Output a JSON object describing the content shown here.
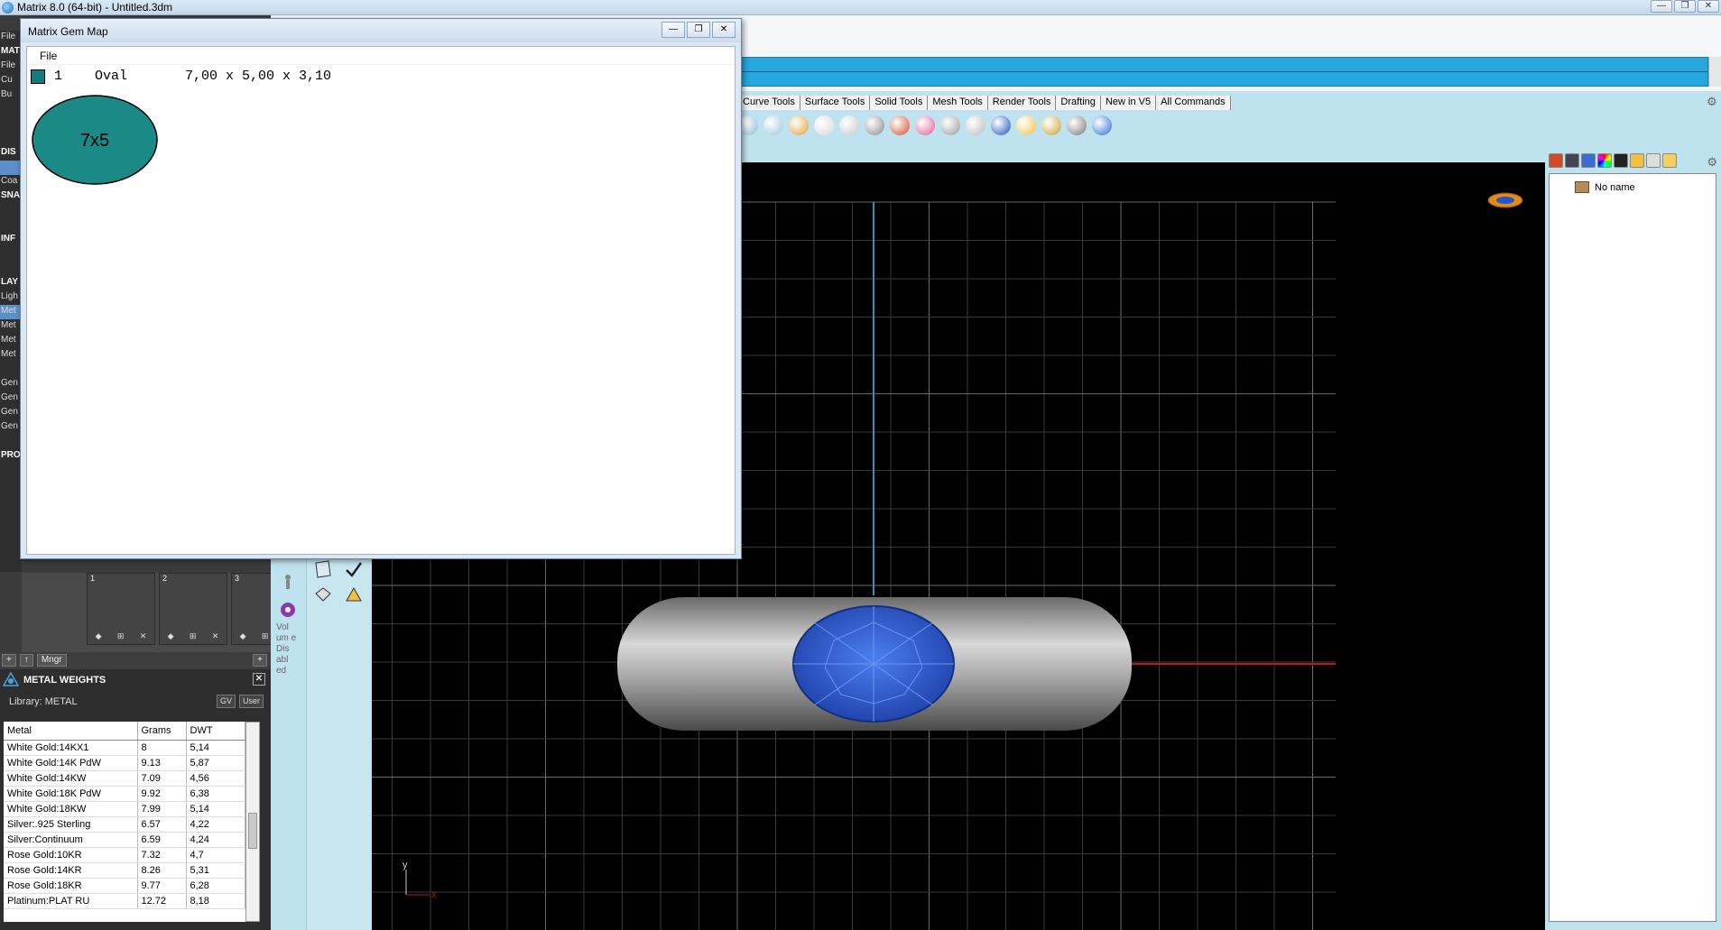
{
  "app": {
    "title": "Matrix 8.0 (64-bit) - Untitled.3dm",
    "window_controls": [
      "—",
      "❐",
      "✕"
    ]
  },
  "left_menu": {
    "items": [
      {
        "label": "File",
        "head": false,
        "hl": false
      },
      {
        "label": "MAT",
        "head": true,
        "hl": false
      },
      {
        "label": "File",
        "head": false,
        "hl": false
      },
      {
        "label": "Cu",
        "head": false,
        "hl": false
      },
      {
        "label": "Bu",
        "head": false,
        "hl": false
      },
      {
        "label": "",
        "head": false,
        "hl": false
      },
      {
        "label": "",
        "head": false,
        "hl": false
      },
      {
        "label": "",
        "head": false,
        "hl": false
      },
      {
        "label": "DIS",
        "head": true,
        "hl": false
      },
      {
        "label": "",
        "head": false,
        "hl": true
      },
      {
        "label": "Coa",
        "head": false,
        "hl": false
      },
      {
        "label": "SNA",
        "head": true,
        "hl": false
      },
      {
        "label": "",
        "head": false,
        "hl": false
      },
      {
        "label": "",
        "head": false,
        "hl": false
      },
      {
        "label": "INF",
        "head": true,
        "hl": false
      },
      {
        "label": "",
        "head": false,
        "hl": false
      },
      {
        "label": "",
        "head": false,
        "hl": false
      },
      {
        "label": "LAY",
        "head": true,
        "hl": false
      },
      {
        "label": "Ligh",
        "head": false,
        "hl": false
      },
      {
        "label": "Met",
        "head": false,
        "hl": true
      },
      {
        "label": "Met",
        "head": false,
        "hl": false
      },
      {
        "label": "Met",
        "head": false,
        "hl": false
      },
      {
        "label": "Met",
        "head": false,
        "hl": false
      },
      {
        "label": "",
        "head": false,
        "hl": false
      },
      {
        "label": "Gen",
        "head": false,
        "hl": false
      },
      {
        "label": "Gen",
        "head": false,
        "hl": false
      },
      {
        "label": "Gen",
        "head": false,
        "hl": false
      },
      {
        "label": "Gen",
        "head": false,
        "hl": false
      },
      {
        "label": "",
        "head": false,
        "hl": false
      },
      {
        "label": "PRO",
        "head": true,
        "hl": false
      }
    ]
  },
  "layer_slots": {
    "slots": [
      "1",
      "2",
      "3"
    ],
    "bar_glyphs": [
      "◆",
      "⊞",
      "✕"
    ],
    "toolbar": [
      "+",
      "↑",
      "Mngr",
      "+"
    ]
  },
  "gem_map": {
    "title": "Matrix Gem Map",
    "menu_file": "File",
    "row": {
      "index": "1",
      "shape": "Oval",
      "size": "7,00 x 5,00 x 3,10"
    },
    "swatch_color": "#137b7b",
    "oval_label": "7x5",
    "oval_color": "#1b8a87"
  },
  "metal_weights": {
    "title": "METAL WEIGHTS",
    "library": "Library: METAL",
    "toggle_gv": "GV",
    "toggle_user": "User",
    "columns": [
      "Metal",
      "Grams",
      "DWT"
    ],
    "rows": [
      [
        "White Gold:14KX1",
        "8",
        "5,14"
      ],
      [
        "White Gold:14K PdW",
        "9.13",
        "5,87"
      ],
      [
        "White Gold:14KW",
        "7.09",
        "4,56"
      ],
      [
        "White Gold:18K PdW",
        "9.92",
        "6,38"
      ],
      [
        "White Gold:18KW",
        "7.99",
        "5,14"
      ],
      [
        "Silver:.925 Sterling",
        "6.57",
        "4,22"
      ],
      [
        "Silver:Continuum",
        "6.59",
        "4,24"
      ],
      [
        "Rose Gold:10KR",
        "7.32",
        "4,7"
      ],
      [
        "Rose Gold:14KR",
        "8.26",
        "5,31"
      ],
      [
        "Rose Gold:18KR",
        "9.77",
        "6,28"
      ],
      [
        "Platinum:PLAT RU",
        "12.72",
        "8,18"
      ]
    ]
  },
  "vertical_text": "Vol um e Dis abl ed",
  "tabs": [
    "Curve Tools",
    "Surface Tools",
    "Solid Tools",
    "Mesh Tools",
    "Render Tools",
    "Drafting",
    "New in V5",
    "All Commands"
  ],
  "right_panel": {
    "tree_root": "No name"
  },
  "viewport": {
    "axis_y_label": "y",
    "axis_x_label": "x",
    "gem_color": "#2357c8",
    "band_color": "#b8b8b8"
  }
}
